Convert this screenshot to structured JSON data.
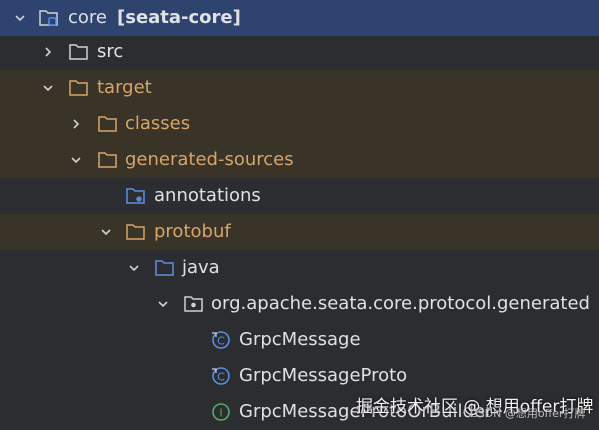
{
  "tree": {
    "root": {
      "name": "core",
      "module": "[seata-core]"
    },
    "src": "src",
    "target": "target",
    "classes": "classes",
    "generated_sources": "generated-sources",
    "annotations": "annotations",
    "protobuf": "protobuf",
    "java": "java",
    "package": "org.apache.seata.core.protocol.generated",
    "items": [
      {
        "label": "GrpcMessage",
        "kind": "class"
      },
      {
        "label": "GrpcMessageProto",
        "kind": "class"
      },
      {
        "label": "GrpcMessageProtoOrBuilder",
        "kind": "interface"
      }
    ]
  },
  "watermark": {
    "main": "掘金技术社区 @ 想用offer打牌",
    "sub": "CSDN @想用offer打牌"
  },
  "colors": {
    "background": "#2b2d30",
    "highlight_row": "#3a3328",
    "folder_orange": "#d7a56a",
    "folder_blue": "#5c8fe0",
    "class_icon": "#5c8fe0",
    "interface_icon": "#59a869"
  }
}
